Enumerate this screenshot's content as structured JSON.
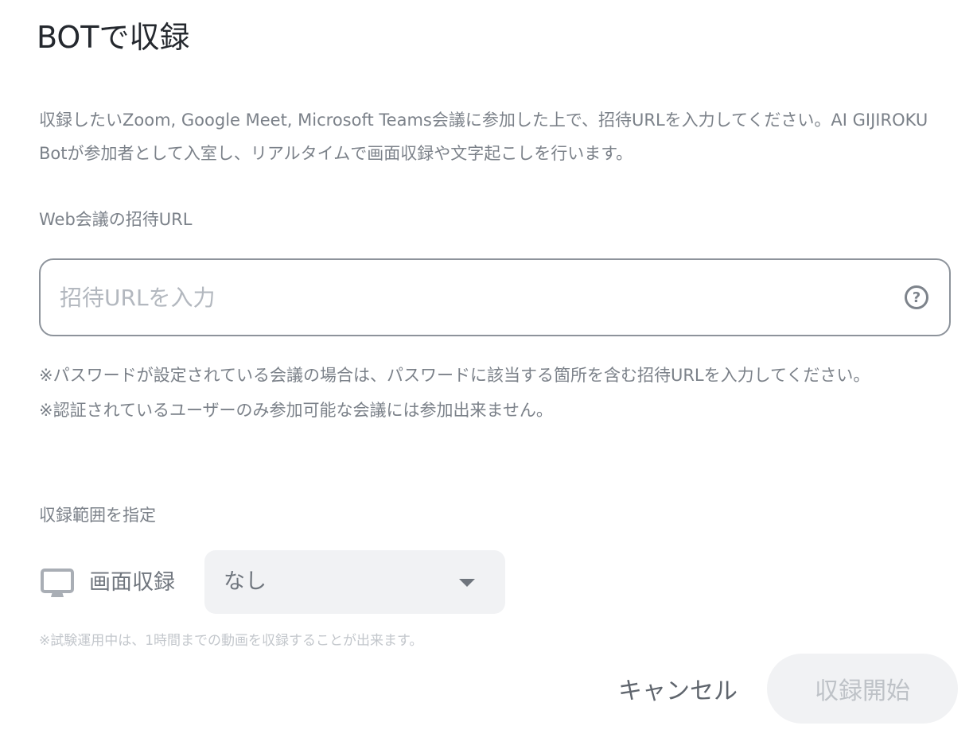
{
  "dialog": {
    "title": "BOTで収録",
    "description": "収録したいZoom, Google Meet, Microsoft Teams会議に参加した上で、招待URLを入力してください。AI GIJIROKU Botが参加者として入室し、リアルタイムで画面収録や文字起こしを行います。"
  },
  "url_section": {
    "label": "Web会議の招待URL",
    "placeholder": "招待URLを入力",
    "value": "",
    "help_icon": "?"
  },
  "notes": [
    "※パスワードが設定されている会議の場合は、パスワードに該当する箇所を含む招待URLを入力してください。",
    "※認証されているユーザーのみ参加可能な会議には参加出来ません。"
  ],
  "range_section": {
    "label": "収録範囲を指定",
    "screen_label": "画面収録",
    "screen_icon": "monitor-icon",
    "select_value": "なし",
    "trial_note": "※試験運用中は、1時間までの動画を収録することが出来ます。"
  },
  "actions": {
    "cancel_label": "キャンセル",
    "start_label": "収録開始"
  },
  "colors": {
    "border": "#8d939b",
    "muted_text": "#7b8189",
    "disabled_bg": "#f1f2f4",
    "disabled_text": "#bec2c7"
  }
}
